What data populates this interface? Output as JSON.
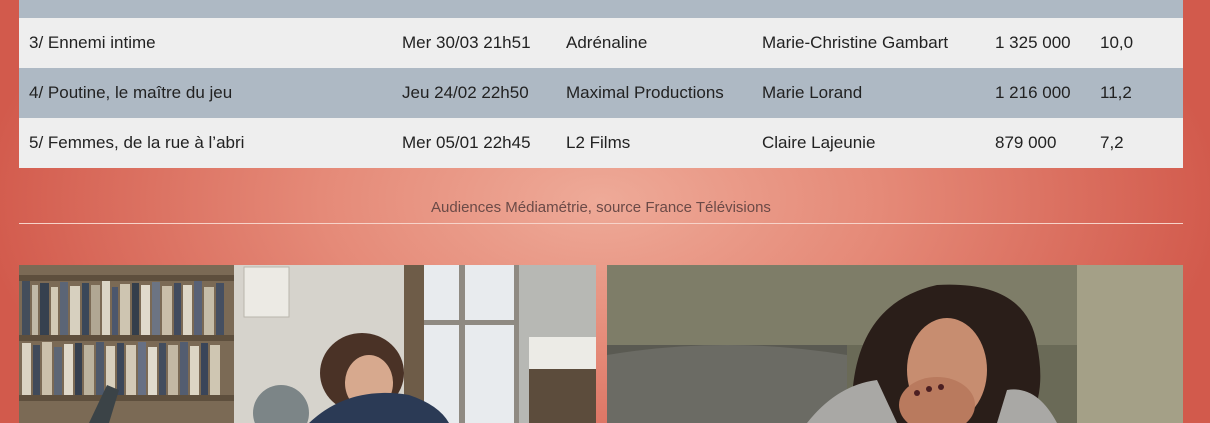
{
  "table": {
    "rows": [
      {
        "title": "3/ Ennemi intime",
        "date": "Mer 30/03 21h51",
        "producer": "Adrénaline",
        "director": "Marie-Christine Gambart",
        "audience": "1 325 000",
        "share": "10,0"
      },
      {
        "title": "4/ Poutine, le maître du jeu",
        "date": "Jeu 24/02 22h50",
        "producer": "Maximal Productions",
        "director": "Marie Lorand",
        "audience": "1 216 000",
        "share": "11,2"
      },
      {
        "title": "5/ Femmes, de la rue à l’abri",
        "date": "Mer 05/01 22h45",
        "producer": "L2 Films",
        "director": "Claire Lajeunie",
        "audience": "879 000",
        "share": "7,2"
      }
    ]
  },
  "caption": "Audiences Médiamétrie, source France Télévisions",
  "colors": {
    "row_alt": "#aeb9c4",
    "row": "#eeeeee",
    "background": "#d25a4c"
  }
}
